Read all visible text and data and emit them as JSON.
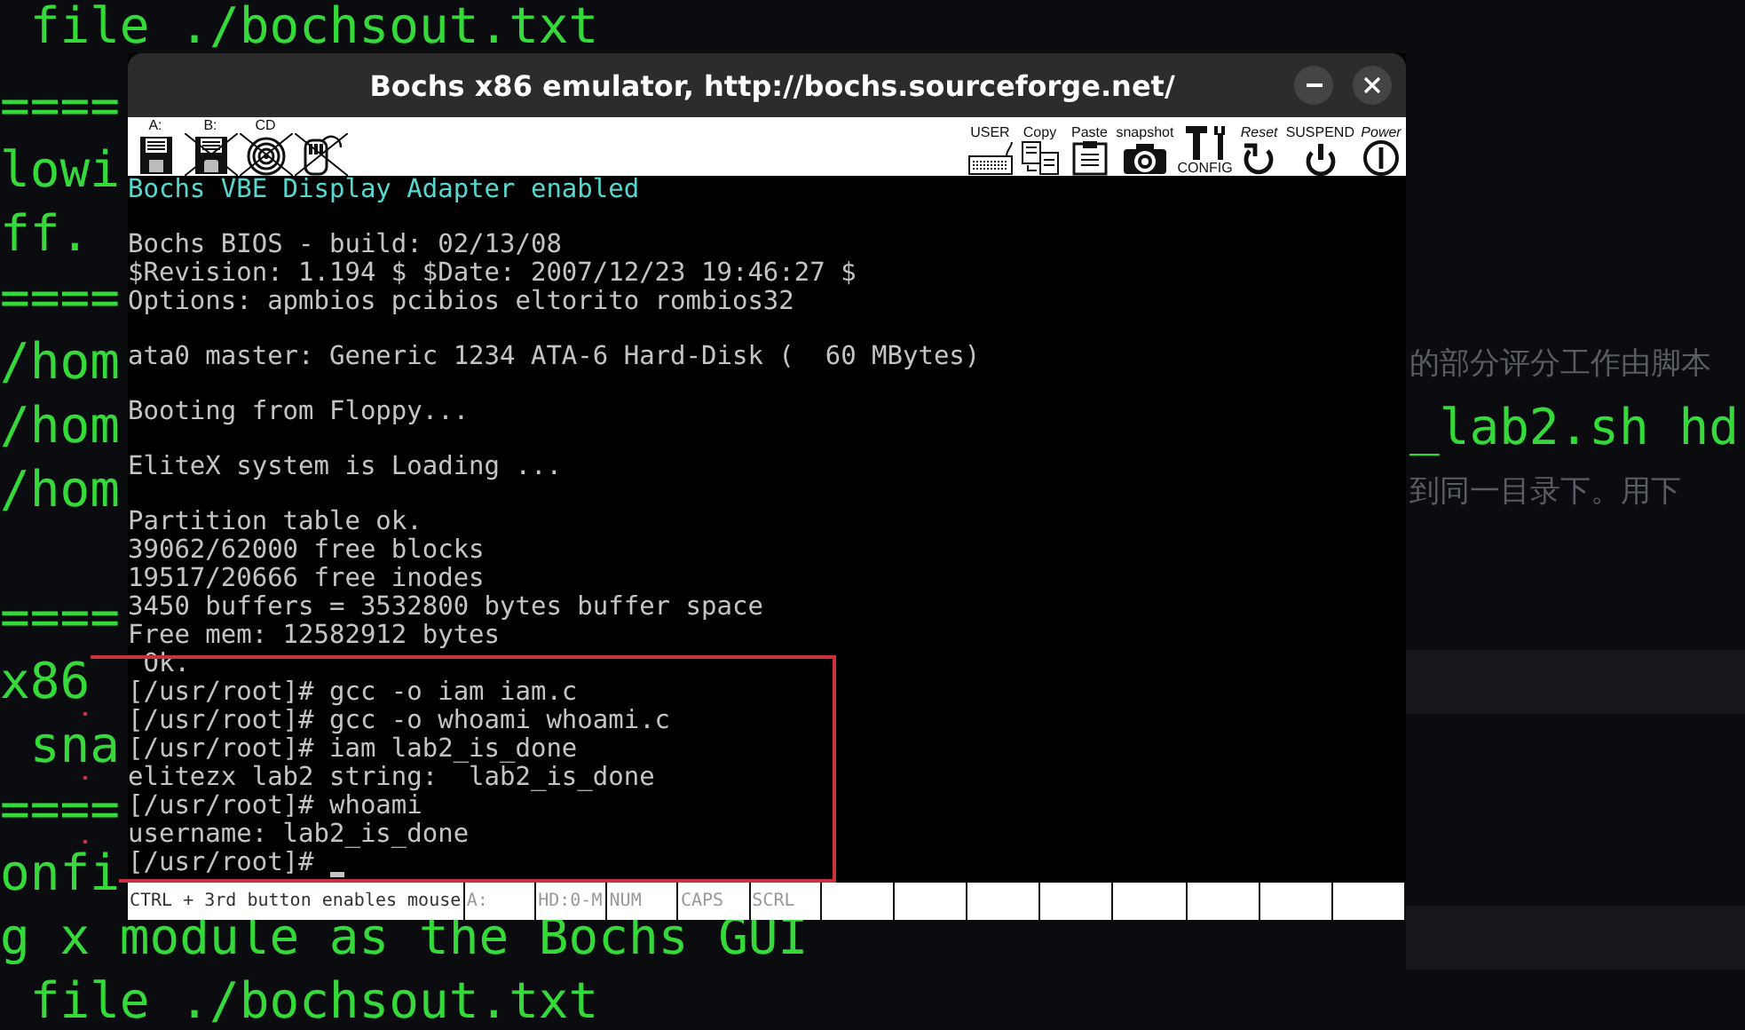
{
  "background": {
    "rows": [
      {
        "left": " file ./bochsout.txt"
      },
      {
        "left": "===="
      },
      {
        "left": "lowi"
      },
      {
        "left": "ff."
      },
      {
        "left": "===="
      },
      {
        "left": "/hom",
        "right": {
          "kind": "prose",
          "text": "的部分评分工作由脚本"
        }
      },
      {
        "left": "/hom",
        "right": {
          "kind": "code",
          "text": "_lab2.sh hd"
        }
      },
      {
        "left": "/hom",
        "right": {
          "kind": "prose",
          "text": "到同一目录下。用下"
        }
      },
      {
        "left": "====",
        "gap_before": true
      },
      {
        "left": "x86",
        "band": true
      },
      {
        "left": " sna"
      },
      {
        "left": "===="
      },
      {
        "left": "onfi"
      },
      {
        "left": "g x module as the Bochs GUI",
        "band": true
      },
      {
        "left": " file ./bochsout.txt"
      }
    ]
  },
  "window": {
    "title": "Bochs x86 emulator, http://bochs.sourceforge.net/",
    "devices": [
      {
        "label": "A:",
        "kind": "floppy",
        "enabled": true
      },
      {
        "label": "B:",
        "kind": "floppy",
        "enabled": false
      },
      {
        "label": "CD",
        "kind": "cdrom",
        "enabled": false
      },
      {
        "kind": "mouse",
        "enabled": false
      }
    ],
    "tools": [
      {
        "label": "USER",
        "kind": "keyboard",
        "label_below": false
      },
      {
        "label": "Copy",
        "kind": "copy",
        "label_below": false
      },
      {
        "label": "Paste",
        "kind": "paste",
        "label_below": false
      },
      {
        "label": "snapshot",
        "kind": "camera",
        "label_below": false
      },
      {
        "label": "CONFIG",
        "kind": "config",
        "label_below": true
      },
      {
        "label": "Reset",
        "kind": "reset",
        "label_below": false
      },
      {
        "label": "SUSPEND",
        "kind": "suspend",
        "label_below": false
      },
      {
        "label": "Power",
        "kind": "power",
        "label_below": false
      }
    ],
    "screen": {
      "cursor": true,
      "blocks": [
        {
          "kind": "banner",
          "lines": [
            "Bochs VBE Display Adapter enabled"
          ]
        },
        {
          "kind": "text",
          "lines": [
            "Bochs BIOS - build: 02/13/08",
            "$Revision: 1.194 $ $Date: 2007/12/23 19:46:27 $",
            "Options: apmbios pcibios eltorito rombios32"
          ]
        },
        {
          "kind": "text",
          "lines": [
            "ata0 master: Generic 1234 ATA-6 Hard-Disk (  60 MBytes)"
          ]
        },
        {
          "kind": "text",
          "lines": [
            "Booting from Floppy..."
          ]
        },
        {
          "kind": "text",
          "lines": [
            "EliteX system is Loading ..."
          ]
        },
        {
          "kind": "text",
          "lines": [
            "Partition table ok.",
            "39062/62000 free blocks",
            "19517/20666 free inodes",
            "3450 buffers = 3532800 bytes buffer space",
            "Free mem: 12582912 bytes",
            " Ok.",
            "[/usr/root]# gcc -o iam iam.c",
            "[/usr/root]# gcc -o whoami whoami.c",
            "[/usr/root]# iam lab2_is_done",
            "elitezx lab2 string:  lab2_is_done",
            "[/usr/root]# whoami",
            "username: lab2_is_done",
            "[/usr/root]# "
          ]
        }
      ]
    },
    "status_bar": {
      "message": "CTRL + 3rd button enables mouse",
      "indicators": [
        {
          "label": "A:",
          "on": false
        },
        {
          "label": "HD:0-M",
          "on": false
        },
        {
          "label": "NUM",
          "on": false
        },
        {
          "label": "CAPS",
          "on": false
        },
        {
          "label": "SCRL",
          "on": false
        }
      ]
    }
  }
}
